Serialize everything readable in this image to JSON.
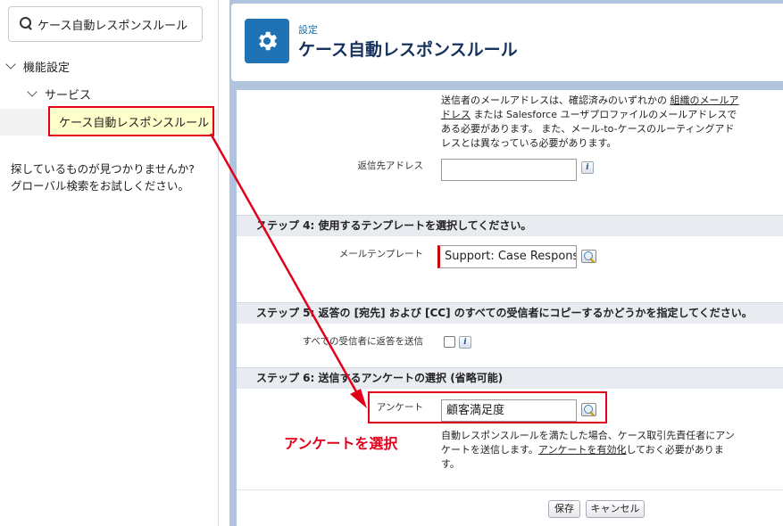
{
  "sidebar": {
    "search_value": "ケース自動レスポンスルール",
    "tree": {
      "features_label": "機能設定",
      "service_label": "サービス",
      "selected_label": "ケース自動レスポンスルール"
    },
    "not_found_line1": "探しているものが見つかりませんか?",
    "not_found_line2": "グローバル検索をお試しください。"
  },
  "header": {
    "breadcrumb": "設定",
    "title": "ケース自動レスポンスルール"
  },
  "form": {
    "intro_line1_a": "送信者のメールアドレスは、確認済みのいずれかの",
    "intro_link1": "組織のメールア",
    "intro_line2_link": "ドレス",
    "intro_line2_b": " または Salesforce ユーザプロファイルのメールアドレスで",
    "intro_line3": "ある必要があります。 また、メール-to-ケースのルーティングアド",
    "intro_line4": "レスとは異なっている必要があります。",
    "reply_to_label": "返信先アドレス",
    "reply_to_value": "",
    "info_glyph": "i",
    "step4_title": "ステップ 4: 使用するテンプレートを選択してください。",
    "email_template_label": "メールテンプレート",
    "email_template_value": "Support: Case Response",
    "step5_title": "ステップ 5: 返答の [宛先] および [CC] のすべての受信者にコピーするかどうかを指定してください。",
    "reply_all_label": "すべての受信者に返答を送信",
    "step6_title": "ステップ 6: 送信するアンケートの選択 (省略可能)",
    "survey_label": "アンケート",
    "survey_value": "顧客満足度",
    "survey_help_line1": "自動レスポンスルールを満たした場合、ケース取引先責任者にアン",
    "survey_help_line2_a": "ケートを送信します。",
    "survey_help_link": "アンケートを有効化",
    "survey_help_line2_b": "しておく必要がありま",
    "survey_help_line3": "す。",
    "save_label": "保存",
    "cancel_label": "キャンセル"
  },
  "annotation": {
    "text": "アンケートを選択"
  },
  "colors": {
    "highlight_red": "#e3001b",
    "brand_blue": "#1f73b5",
    "main_background": "#b0c4df"
  }
}
